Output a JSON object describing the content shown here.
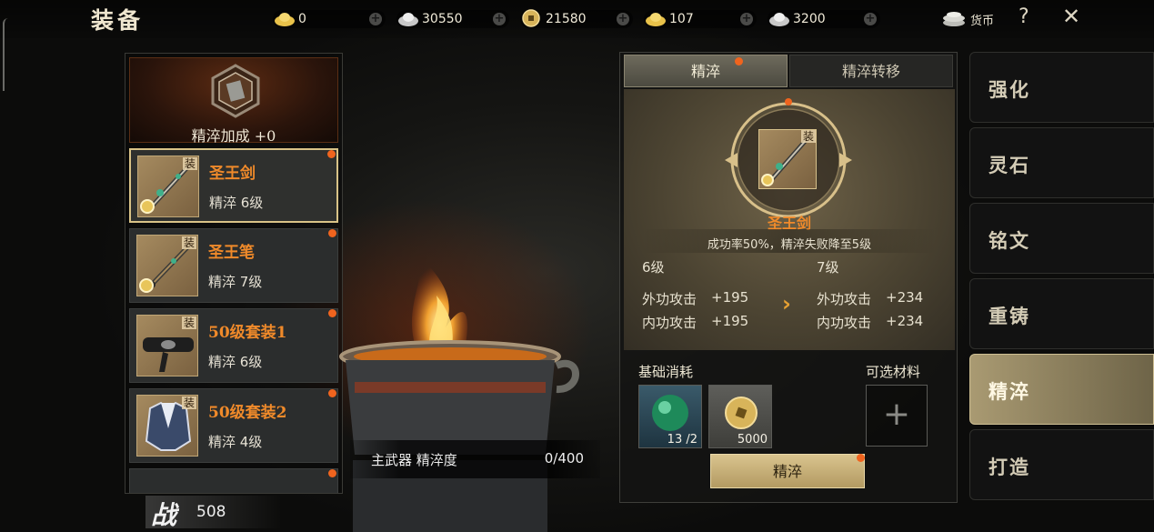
{
  "header": {
    "title": "装备",
    "currencies": [
      {
        "icon": "gold-ingot-icon",
        "value": "0"
      },
      {
        "icon": "silver-ingot-icon",
        "value": "30550"
      },
      {
        "icon": "copper-coin-icon",
        "value": "21580"
      },
      {
        "icon": "gold-ingot-icon",
        "value": "107"
      },
      {
        "icon": "silver-ingot-icon",
        "value": "3200"
      }
    ],
    "currency_button": "货币",
    "help": "?",
    "close": "✕"
  },
  "left_panel": {
    "bonus": "精淬加成 +0",
    "items": [
      {
        "name": "圣王剑",
        "level": "精淬 6级",
        "tag": "装",
        "selected": true
      },
      {
        "name": "圣王笔",
        "level": "精淬 7级",
        "tag": "装",
        "selected": false
      },
      {
        "name": "50级套装1",
        "level": "精淬 6级",
        "tag": "装",
        "selected": false
      },
      {
        "name": "50级套装2",
        "level": "精淬 4级",
        "tag": "装",
        "selected": false
      }
    ]
  },
  "power": {
    "glyph": "战",
    "value": "508"
  },
  "progress": {
    "label": "主武器 精淬度",
    "value": "0/400"
  },
  "refine_panel": {
    "tabs": [
      "精淬",
      "精淬转移"
    ],
    "item_tag": "装",
    "weapon_name": "圣王剑",
    "rate_text": "成功率50%，精淬失败降至5级",
    "current_level": "6级",
    "next_level": "7级",
    "current_stats": [
      {
        "label": "外功攻击",
        "value": "+195"
      },
      {
        "label": "内功攻击",
        "value": "+195"
      }
    ],
    "next_stats": [
      {
        "label": "外功攻击",
        "value": "+234"
      },
      {
        "label": "内功攻击",
        "value": "+234"
      }
    ],
    "base_cost_label": "基础消耗",
    "optional_label": "可选材料",
    "materials": [
      {
        "icon": "green-orb-icon",
        "qty": "13 /2"
      },
      {
        "icon": "copper-coin-icon",
        "qty": "5000"
      }
    ],
    "button": "精淬"
  },
  "side_nav": {
    "items": [
      "强化",
      "灵石",
      "铭文",
      "重铸",
      "精淬",
      "打造"
    ],
    "active": "精淬"
  }
}
